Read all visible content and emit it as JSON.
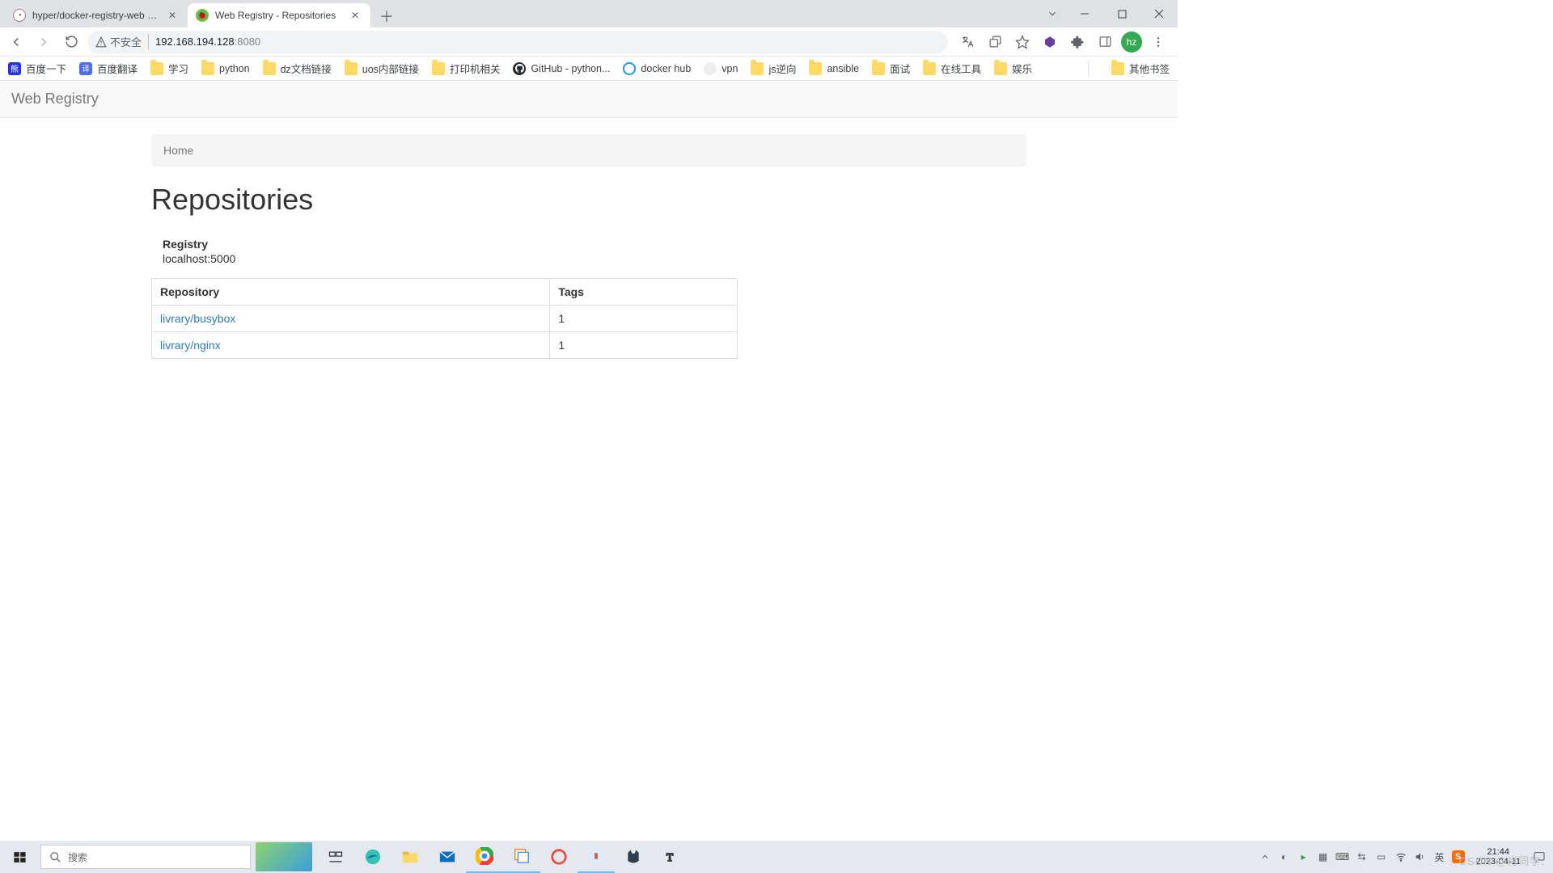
{
  "browser": {
    "tabs": [
      {
        "title": "hyper/docker-registry-web - D",
        "active": false
      },
      {
        "title": "Web Registry - Repositories",
        "active": true
      }
    ],
    "address": {
      "security_label": "不安全",
      "host": "192.168.194.128",
      "port": ":8080"
    },
    "bookmarks": [
      {
        "label": "百度一下",
        "kind": "baidu"
      },
      {
        "label": "百度翻译",
        "kind": "fanyi"
      },
      {
        "label": "学习",
        "kind": "folder"
      },
      {
        "label": "python",
        "kind": "folder"
      },
      {
        "label": "dz文档链接",
        "kind": "folder"
      },
      {
        "label": "uos内部链接",
        "kind": "folder"
      },
      {
        "label": "打印机相关",
        "kind": "folder"
      },
      {
        "label": "GitHub - python...",
        "kind": "github"
      },
      {
        "label": "docker hub",
        "kind": "docker"
      },
      {
        "label": "vpn",
        "kind": "vpn"
      },
      {
        "label": "js逆向",
        "kind": "folder"
      },
      {
        "label": "ansible",
        "kind": "folder"
      },
      {
        "label": "面试",
        "kind": "folder"
      },
      {
        "label": "在线工具",
        "kind": "folder"
      },
      {
        "label": "娱乐",
        "kind": "folder"
      }
    ],
    "other_bookmarks_label": "其他书签",
    "avatar_initials": "hz"
  },
  "page": {
    "brand": "Web Registry",
    "breadcrumb": "Home",
    "heading": "Repositories",
    "registry_label": "Registry",
    "registry_url": "localhost:5000",
    "columns": {
      "repo": "Repository",
      "tags": "Tags"
    },
    "rows": [
      {
        "name": "livrary/busybox",
        "tags": "1"
      },
      {
        "name": "livrary/nginx",
        "tags": "1"
      }
    ]
  },
  "taskbar": {
    "search_placeholder": "搜索",
    "clock_time": "21:44",
    "clock_date": "2023-04-11",
    "watermark": "CSDN @肖同学."
  }
}
